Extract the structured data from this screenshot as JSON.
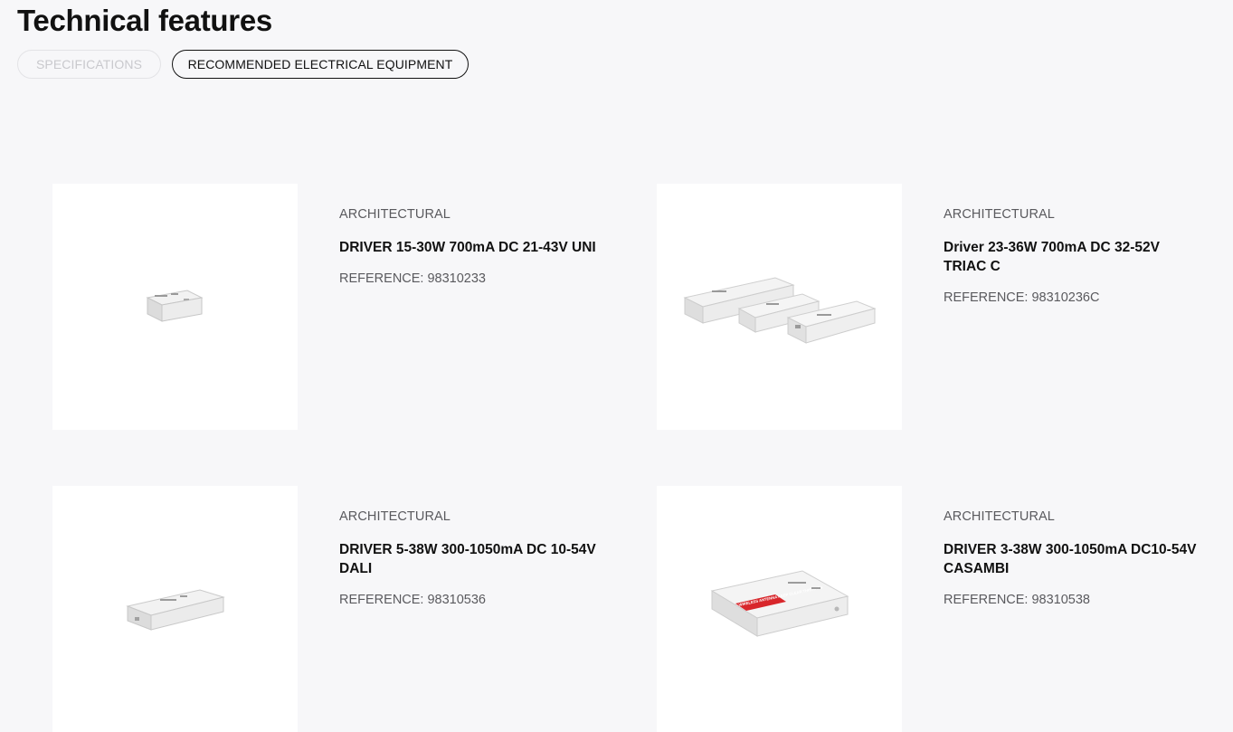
{
  "header": {
    "title": "Technical features"
  },
  "tabs": [
    {
      "label": "SPECIFICATIONS"
    },
    {
      "label": "RECOMMENDED ELECTRICAL EQUIPMENT"
    }
  ],
  "products": [
    {
      "category": "ARCHITECTURAL",
      "name": "DRIVER 15-30W 700mA DC 21-43V UNI",
      "reference": "REFERENCE: 98310233"
    },
    {
      "category": "ARCHITECTURAL",
      "name": "Driver 23-36W 700mA DC 32-52V TRIAC C",
      "reference": "REFERENCE: 98310236C"
    },
    {
      "category": "ARCHITECTURAL",
      "name": "DRIVER 5-38W 300-1050mA DC 10-54V DALI",
      "reference": "REFERENCE: 98310536"
    },
    {
      "category": "ARCHITECTURAL",
      "name": "DRIVER 3-38W 300-1050mA DC10-54V CASAMBI",
      "reference": "REFERENCE: 98310538"
    }
  ],
  "label_text": "WIRELESS ANTENNA KEEP CLEAR THIS AREA",
  "colors": {
    "background": "#f7f7f9",
    "card": "#ffffff",
    "accent_red": "#d8262b"
  }
}
